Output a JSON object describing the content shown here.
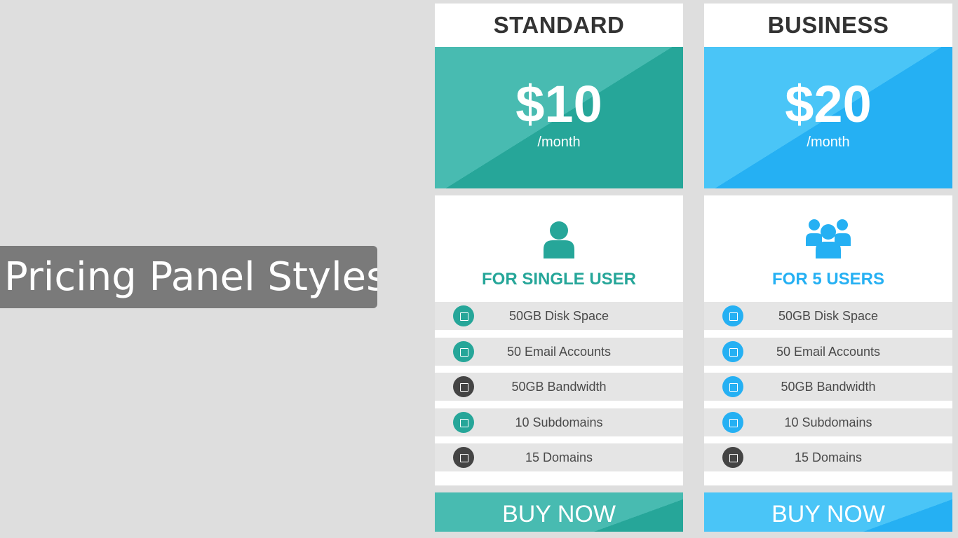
{
  "page_title": "Pricing Panel Styles",
  "colors": {
    "standard_accent": "#26a699",
    "business_accent": "#25b0f3",
    "dark_dot": "#444444",
    "background": "#dedede"
  },
  "plans": [
    {
      "name": "STANDARD",
      "price": "$10",
      "period": "/month",
      "icon": "single-user-icon",
      "audience": "FOR SINGLE USER",
      "features": [
        {
          "label": "50GB Disk Space",
          "dot": "accent"
        },
        {
          "label": "50 Email Accounts",
          "dot": "accent"
        },
        {
          "label": "50GB Bandwidth",
          "dot": "dark"
        },
        {
          "label": "10 Subdomains",
          "dot": "accent"
        },
        {
          "label": "15 Domains",
          "dot": "dark"
        }
      ],
      "button": "BUY NOW"
    },
    {
      "name": "BUSINESS",
      "price": "$20",
      "period": "/month",
      "icon": "group-users-icon",
      "audience": "FOR 5 USERS",
      "features": [
        {
          "label": "50GB Disk Space",
          "dot": "accent"
        },
        {
          "label": "50 Email Accounts",
          "dot": "accent"
        },
        {
          "label": "50GB Bandwidth",
          "dot": "accent"
        },
        {
          "label": "10 Subdomains",
          "dot": "accent"
        },
        {
          "label": "15 Domains",
          "dot": "dark"
        }
      ],
      "button": "BUY NOW"
    }
  ]
}
